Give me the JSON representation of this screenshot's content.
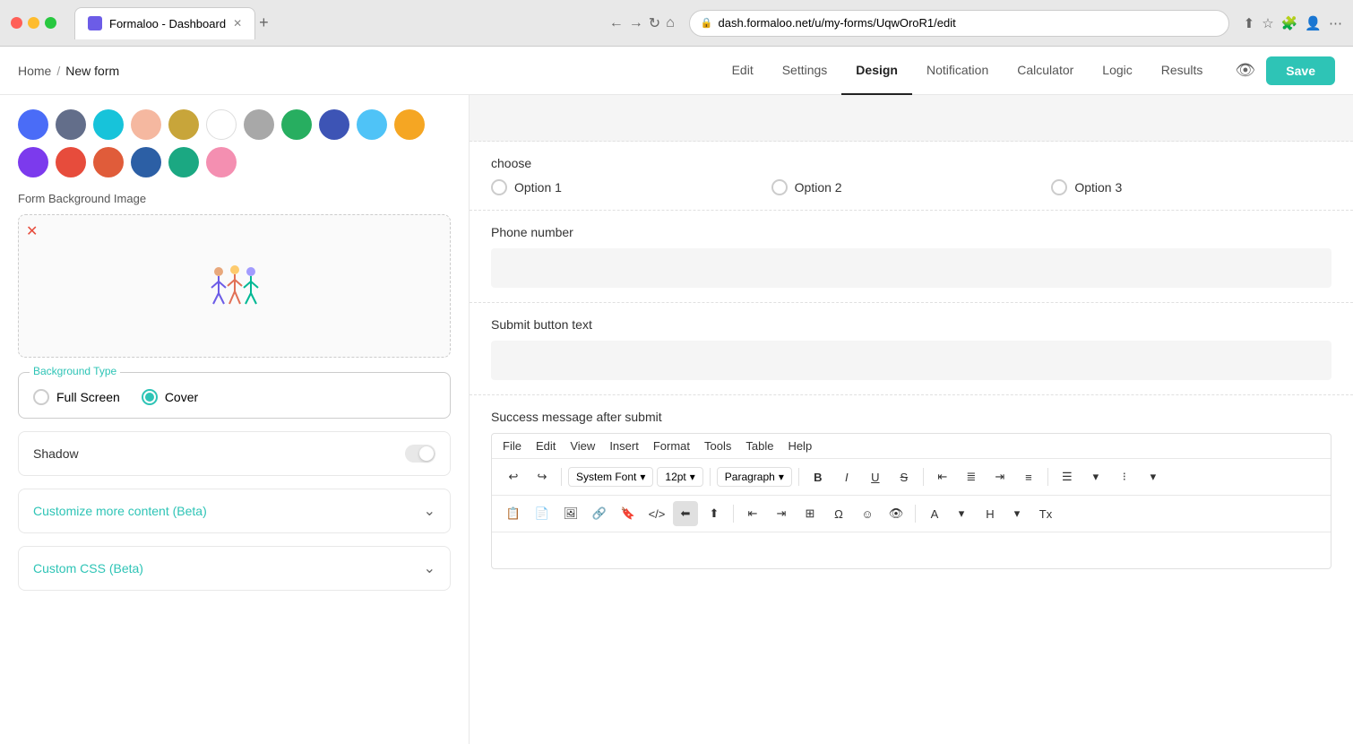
{
  "browser": {
    "url": "dash.formaloo.net/u/my-forms/UqwOroR1/edit",
    "tab_title": "Formaloo - Dashboard",
    "new_tab_icon": "+"
  },
  "breadcrumb": {
    "home": "Home",
    "separator": "/",
    "current": "New form"
  },
  "nav_tabs": [
    {
      "id": "edit",
      "label": "Edit"
    },
    {
      "id": "settings",
      "label": "Settings"
    },
    {
      "id": "design",
      "label": "Design",
      "active": true
    },
    {
      "id": "notification",
      "label": "Notification"
    },
    {
      "id": "calculator",
      "label": "Calculator"
    },
    {
      "id": "logic",
      "label": "Logic"
    },
    {
      "id": "results",
      "label": "Results"
    }
  ],
  "save_button": "Save",
  "colors": {
    "row1": [
      "#4a6cf7",
      "#636e8a",
      "#17c3da",
      "#f5b8a0",
      "#c8a53a",
      "#ffffff",
      "#a8a8a8",
      "#27ae60",
      "#3d54b5",
      "#4fc3f7",
      "#f5a623"
    ],
    "row2": [
      "#7c3aed",
      "#e74c3c",
      "#e05c3a",
      "#2c5fa5",
      "#1ba882",
      "#f48fb1"
    ]
  },
  "form_background_image_label": "Form Background Image",
  "background_type": {
    "section_label": "Background Type",
    "full_screen_label": "Full Screen",
    "cover_label": "Cover",
    "selected": "Cover"
  },
  "shadow": {
    "label": "Shadow",
    "enabled": false
  },
  "customize": {
    "label": "Customize more content",
    "badge": "(Beta)"
  },
  "custom_css": {
    "label": "Custom CSS",
    "badge": "(Beta)"
  },
  "form_fields": {
    "choose_label": "choose",
    "options": [
      {
        "label": "Option 1"
      },
      {
        "label": "Option 2"
      },
      {
        "label": "Option 3"
      }
    ],
    "phone_number_label": "Phone number",
    "submit_button_label": "Submit button text",
    "success_message_label": "Success message after submit"
  },
  "editor": {
    "menu": [
      "File",
      "Edit",
      "View",
      "Insert",
      "Format",
      "Tools",
      "Table",
      "Help"
    ],
    "font_family": "System Font",
    "font_size": "12pt",
    "paragraph_style": "Paragraph",
    "toolbar_buttons": [
      "undo",
      "redo",
      "bold",
      "italic",
      "underline",
      "strikethrough",
      "align-left",
      "align-center",
      "align-right",
      "align-justify",
      "ordered-list",
      "unordered-list",
      "indent-left",
      "indent-right",
      "paste",
      "paste-special",
      "image",
      "link",
      "bookmark",
      "code",
      "ltr",
      "rtl",
      "table",
      "font-color",
      "highlight",
      "clear-format",
      "omega",
      "emoji",
      "visibility"
    ]
  }
}
